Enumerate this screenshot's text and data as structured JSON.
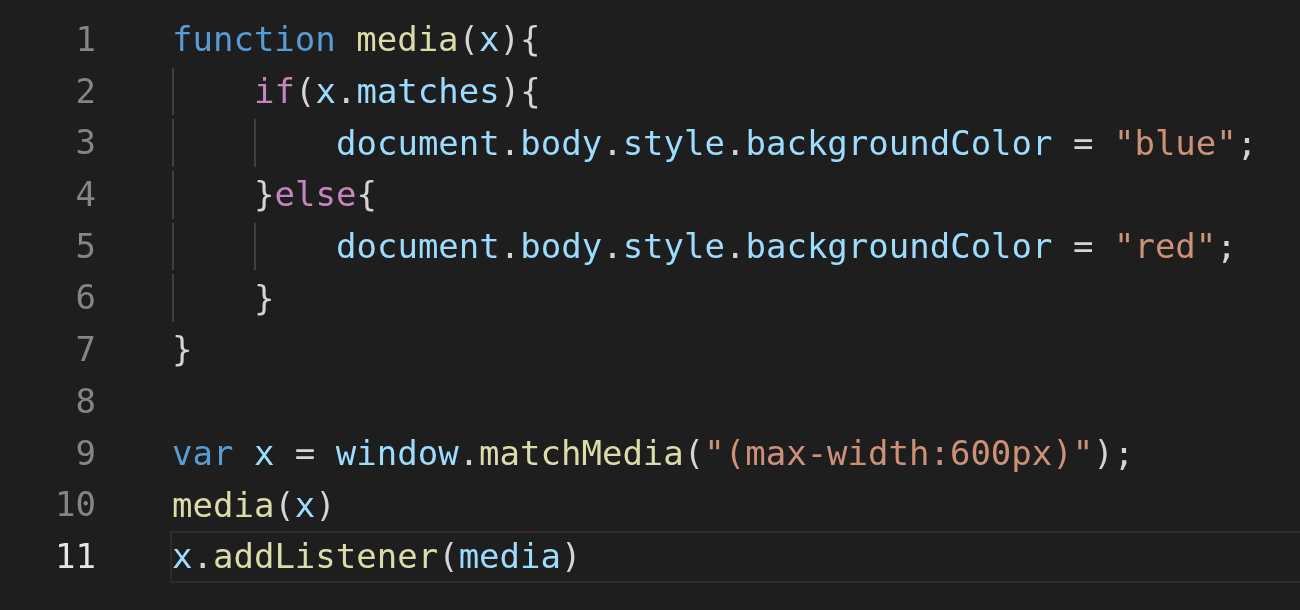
{
  "editor": {
    "lines": [
      {
        "number": "1",
        "current": false,
        "tokens": [
          {
            "kind": "keyword",
            "text": "function "
          },
          {
            "kind": "func",
            "text": "media"
          },
          {
            "kind": "punct",
            "text": "("
          },
          {
            "kind": "var",
            "text": "x"
          },
          {
            "kind": "punct",
            "text": "){"
          }
        ],
        "children": [
          {
            "number": "2",
            "current": false,
            "tokens": [
              {
                "kind": "control",
                "text": "if"
              },
              {
                "kind": "punct",
                "text": "("
              },
              {
                "kind": "var",
                "text": "x"
              },
              {
                "kind": "punct",
                "text": "."
              },
              {
                "kind": "var",
                "text": "matches"
              },
              {
                "kind": "punct",
                "text": "){"
              }
            ],
            "children": [
              {
                "number": "3",
                "current": false,
                "tokens": [
                  {
                    "kind": "var",
                    "text": "document"
                  },
                  {
                    "kind": "punct",
                    "text": "."
                  },
                  {
                    "kind": "var",
                    "text": "body"
                  },
                  {
                    "kind": "punct",
                    "text": "."
                  },
                  {
                    "kind": "var",
                    "text": "style"
                  },
                  {
                    "kind": "punct",
                    "text": "."
                  },
                  {
                    "kind": "var",
                    "text": "backgroundColor"
                  },
                  {
                    "kind": "punct",
                    "text": " = "
                  },
                  {
                    "kind": "string",
                    "text": "\"blue\""
                  },
                  {
                    "kind": "punct",
                    "text": ";"
                  }
                ]
              }
            ]
          },
          {
            "number": "4",
            "current": false,
            "tokens": [
              {
                "kind": "punct",
                "text": "}"
              },
              {
                "kind": "control",
                "text": "else"
              },
              {
                "kind": "punct",
                "text": "{"
              }
            ],
            "children": [
              {
                "number": "5",
                "current": false,
                "tokens": [
                  {
                    "kind": "var",
                    "text": "document"
                  },
                  {
                    "kind": "punct",
                    "text": "."
                  },
                  {
                    "kind": "var",
                    "text": "body"
                  },
                  {
                    "kind": "punct",
                    "text": "."
                  },
                  {
                    "kind": "var",
                    "text": "style"
                  },
                  {
                    "kind": "punct",
                    "text": "."
                  },
                  {
                    "kind": "var",
                    "text": "backgroundColor"
                  },
                  {
                    "kind": "punct",
                    "text": " = "
                  },
                  {
                    "kind": "string",
                    "text": "\"red\""
                  },
                  {
                    "kind": "punct",
                    "text": ";"
                  }
                ]
              }
            ]
          },
          {
            "number": "6",
            "current": false,
            "tokens": [
              {
                "kind": "punct",
                "text": "}"
              }
            ]
          }
        ]
      },
      {
        "number": "7",
        "current": false,
        "tokens": [
          {
            "kind": "punct",
            "text": "}"
          }
        ]
      },
      {
        "number": "8",
        "current": false
      },
      {
        "number": "9",
        "current": false,
        "tokens": [
          {
            "kind": "keyword",
            "text": "var "
          },
          {
            "kind": "var",
            "text": "x"
          },
          {
            "kind": "punct",
            "text": " = "
          },
          {
            "kind": "var",
            "text": "window"
          },
          {
            "kind": "punct",
            "text": "."
          },
          {
            "kind": "func",
            "text": "matchMedia"
          },
          {
            "kind": "punct",
            "text": "("
          },
          {
            "kind": "string",
            "text": "\"(max-width:600px)\""
          },
          {
            "kind": "punct",
            "text": ");"
          }
        ]
      },
      {
        "number": "10",
        "current": false,
        "tokens": [
          {
            "kind": "func",
            "text": "media"
          },
          {
            "kind": "punct",
            "text": "("
          },
          {
            "kind": "var",
            "text": "x"
          },
          {
            "kind": "punct",
            "text": ")"
          }
        ]
      },
      {
        "number": "11",
        "current": true,
        "tokens": [
          {
            "kind": "var",
            "text": "x"
          },
          {
            "kind": "punct",
            "text": "."
          },
          {
            "kind": "func",
            "text": "addListener"
          },
          {
            "kind": "punct",
            "text": "("
          },
          {
            "kind": "var",
            "text": "media"
          },
          {
            "kind": "punct",
            "text": ")"
          }
        ]
      }
    ]
  }
}
